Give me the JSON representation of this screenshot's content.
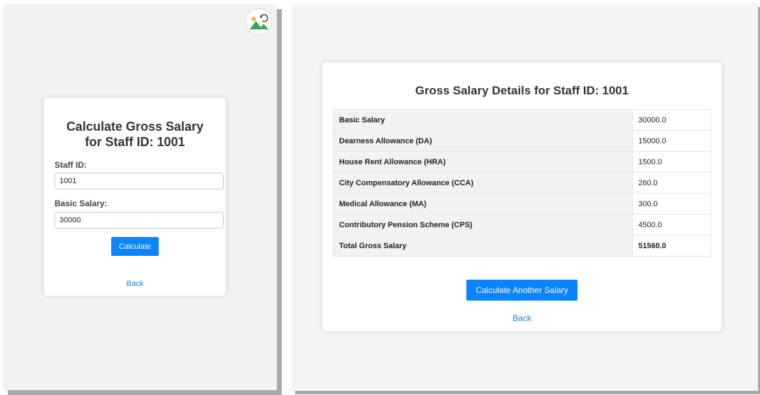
{
  "left": {
    "card": {
      "title_line1": "Calculate Gross Salary",
      "title_line2": "for Staff ID: 1001",
      "staff_id_label": "Staff ID:",
      "staff_id_value": "1001",
      "basic_salary_label": "Basic Salary:",
      "basic_salary_value": "30000",
      "calculate_button": "Calculate",
      "back_link": "Back"
    },
    "avatar_icon": "image-refresh-icon"
  },
  "right": {
    "title": "Gross Salary Details for Staff ID: 1001",
    "rows": [
      {
        "label": "Basic Salary",
        "value": "30000.0"
      },
      {
        "label": "Dearness Allowance (DA)",
        "value": "15000.0"
      },
      {
        "label": "House Rent Allowance (HRA)",
        "value": "1500.0"
      },
      {
        "label": "City Compensatory Allowance (CCA)",
        "value": "260.0"
      },
      {
        "label": "Medical Allowance (MA)",
        "value": "300.0"
      },
      {
        "label": "Contributory Pension Scheme (CPS)",
        "value": "4500.0"
      },
      {
        "label": "Total Gross Salary",
        "value": "51560.0"
      }
    ],
    "calculate_another_button": "Calculate Another Salary",
    "back_link": "Back"
  },
  "colors": {
    "accent": "#0a84ff",
    "link": "#1e7be6",
    "panel_bg": "#f2f2f2"
  }
}
